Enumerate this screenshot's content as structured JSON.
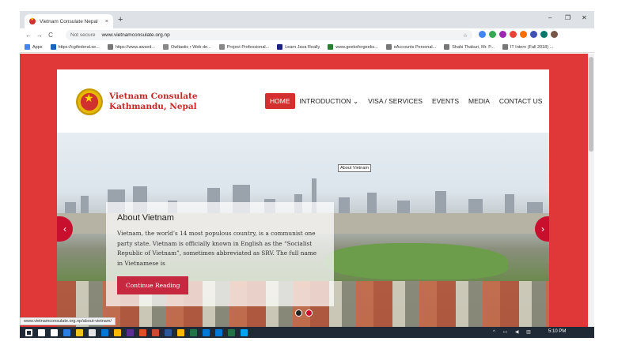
{
  "browser": {
    "tab_title": "Vietnam Consulate Nepal",
    "tab_close": "×",
    "new_tab": "+",
    "window_controls": [
      "–",
      "❐",
      "✕"
    ],
    "nav": [
      "←",
      "→",
      "C"
    ],
    "security": "Not secure",
    "url": "www.vietnamconsulate.org.np",
    "star": "☆",
    "bookmarks": [
      "Apps",
      "https://cgifederal.se...",
      "https://www.awsed...",
      "Owltastic • Web de...",
      "Project Professional...",
      "Learn Java Really",
      "www.geeksforgeeks...",
      "eAccounts Personal...",
      "Shahi Thakuri, Mr. P...",
      "IT Intern (Fall 2018) ..."
    ],
    "bookmark_colors": [
      "#4285f4",
      "#1565c0",
      "#777777",
      "#888888",
      "#888888",
      "#1a237e",
      "#2e7d32",
      "#777777",
      "#777777",
      "#777777"
    ],
    "extension_colors": [
      "#4285f4",
      "#34a853",
      "#9c27b0",
      "#ea4335",
      "#ff6f00",
      "#3f51b5",
      "#00796b",
      "#795548"
    ],
    "status_url": "www.vietnamconsulate.org.np/about-vietnam/"
  },
  "site": {
    "brand_line1": "Vietnam Consulate",
    "brand_line2": "Kathmandu, Nepal",
    "nav": {
      "home": "HOME",
      "introduction": "INTRODUCTION ⌄",
      "visa": "VISA / SERVICES",
      "events": "EVENTS",
      "media": "MEDIA",
      "contact": "CONTACT US"
    },
    "tooltip": "About Vietnam",
    "slide": {
      "title": "About Vietnam",
      "body": "Vietnam, the world’s 14 most populous country, is a communist one party state. Vietnam is officially known in English as the “Socialist Republic of Vietnam”, sometimes abbreviated as SRV. The full name in Vietnamese is",
      "button": "Continue Reading"
    },
    "prev_arrow": "‹",
    "next_arrow": "›",
    "colors": {
      "accent": "#e03838",
      "button": "#c62840"
    }
  },
  "taskbar": {
    "time": "5:10 PM",
    "icon_colors": [
      "#ffffff",
      "#ffffff",
      "#ffffff",
      "#2a7de1",
      "#f0c419",
      "#e4e4e4",
      "#0078d7",
      "#ffb900",
      "#5c2d91",
      "#e04f26",
      "#cc4a31",
      "#2b579a",
      "#ffb900",
      "#227447",
      "#0078d7",
      "#0078d7",
      "#217346",
      "#00a4ef"
    ]
  }
}
